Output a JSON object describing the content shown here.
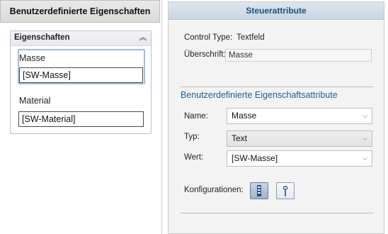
{
  "left": {
    "header": "Benutzerdefinierte Eigenschaften",
    "group_title": "Eigenschaften",
    "fields": [
      {
        "label": "Masse",
        "value": "[SW-Masse]"
      },
      {
        "label": "Material",
        "value": "[SW-Material]"
      }
    ]
  },
  "right": {
    "header": "Steuerattribute",
    "control_type_label": "Control Type:",
    "control_type_value": "Textfeld",
    "caption_label": "Überschrift:",
    "caption_value": "Masse",
    "section_title": "Benutzerdefinierte Eigenschaftsattribute",
    "name_label": "Name:",
    "name_value": "Masse",
    "type_label": "Typ:",
    "type_value": "Text",
    "value_label": "Wert:",
    "value_value": "[SW-Masse]",
    "configurations_label": "Konfigurationen:"
  },
  "icons": {
    "collapse": "double-chevron-up-icon",
    "dropdown": "chevron-down-icon",
    "config_all": "config-all-icon",
    "config_specific": "config-specific-icon"
  },
  "colors": {
    "right_header_text": "#1f4f7d",
    "section_title": "#1f5d93"
  }
}
